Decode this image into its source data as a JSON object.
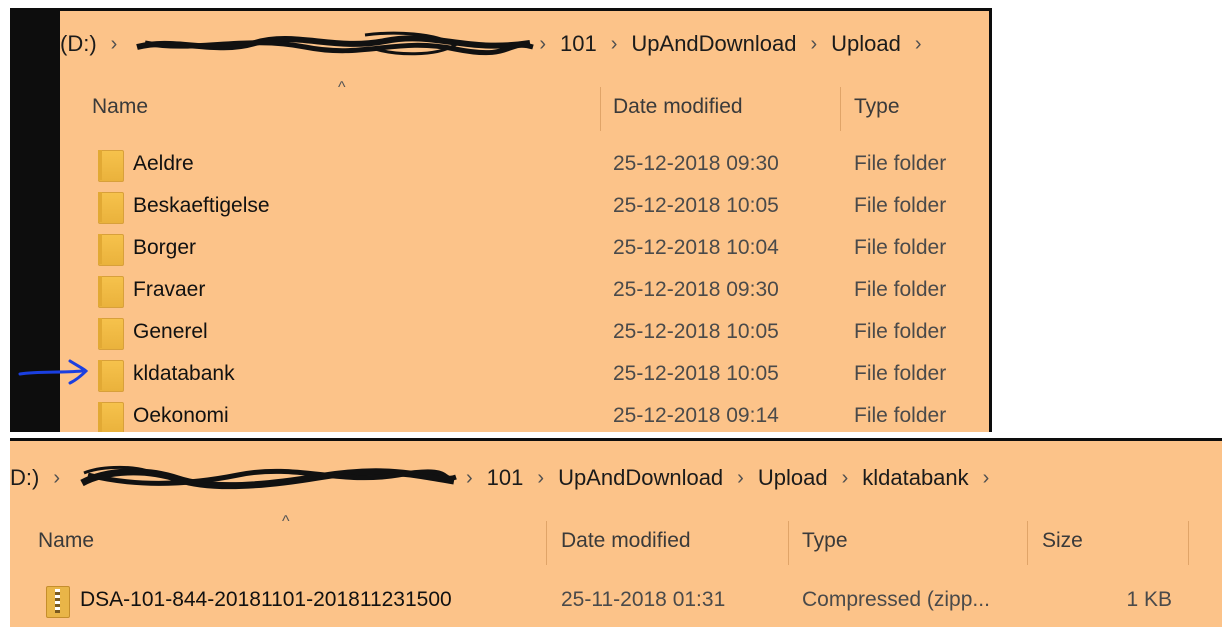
{
  "upper": {
    "breadcrumb": {
      "drive": "(D:)",
      "items": [
        "101",
        "UpAndDownload",
        "Upload"
      ]
    },
    "columns": {
      "name": "Name",
      "date": "Date modified",
      "type": "Type"
    },
    "rows": [
      {
        "name": "Aeldre",
        "date": "25-12-2018 09:30",
        "type": "File folder"
      },
      {
        "name": "Beskaeftigelse",
        "date": "25-12-2018 10:05",
        "type": "File folder"
      },
      {
        "name": "Borger",
        "date": "25-12-2018 10:04",
        "type": "File folder"
      },
      {
        "name": "Fravaer",
        "date": "25-12-2018 09:30",
        "type": "File folder"
      },
      {
        "name": "Generel",
        "date": "25-12-2018 10:05",
        "type": "File folder"
      },
      {
        "name": "kldatabank",
        "date": "25-12-2018 10:05",
        "type": "File folder"
      },
      {
        "name": "Oekonomi",
        "date": "25-12-2018 09:14",
        "type": "File folder"
      }
    ],
    "highlighted_row": "kldatabank"
  },
  "lower": {
    "breadcrumb": {
      "drive": "D:)",
      "items": [
        "101",
        "UpAndDownload",
        "Upload",
        "kldatabank"
      ]
    },
    "columns": {
      "name": "Name",
      "date": "Date modified",
      "type": "Type",
      "size": "Size"
    },
    "rows": [
      {
        "name": "DSA-101-844-20181101-201811231500",
        "date": "25-11-2018 01:31",
        "type": "Compressed (zipp...",
        "size": "1 KB"
      }
    ]
  },
  "colors": {
    "window_bg": "#fcc389",
    "frame": "#0d0d0d",
    "annotation_arrow": "#1a3fe0",
    "scribble": "#111111"
  },
  "icons": {
    "folder": "folder-icon",
    "zip": "zip-archive-icon",
    "sort": "sort-up-icon",
    "annotation": "hand-drawn-arrow-icon"
  }
}
